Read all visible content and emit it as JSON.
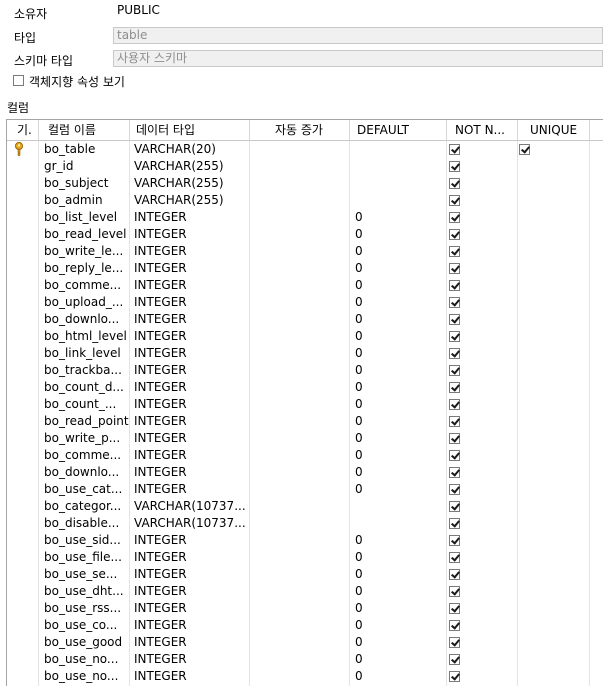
{
  "form": {
    "owner_label": "소유자",
    "owner_value": "PUBLIC",
    "type_label": "타입",
    "type_value": "table",
    "schema_type_label": "스키마 타입",
    "schema_type_value": "사용자 스키마",
    "oo_checkbox_label": "객체지향 속성 보기",
    "oo_checked": false
  },
  "section": {
    "title": "컬럼"
  },
  "grid": {
    "columns": [
      "기.",
      "컬럼 이름",
      "데이터 타입",
      "자동 증가",
      "DEFAULT",
      "NOT N...",
      "UNIQUE"
    ],
    "rows": [
      {
        "key": true,
        "name": "bo_table",
        "type": "VARCHAR(20)",
        "auto": "",
        "def": "",
        "notnull": true,
        "unique": true
      },
      {
        "key": false,
        "name": "gr_id",
        "type": "VARCHAR(255)",
        "auto": "",
        "def": "",
        "notnull": true,
        "unique": false
      },
      {
        "key": false,
        "name": "bo_subject",
        "type": "VARCHAR(255)",
        "auto": "",
        "def": "",
        "notnull": true,
        "unique": false
      },
      {
        "key": false,
        "name": "bo_admin",
        "type": "VARCHAR(255)",
        "auto": "",
        "def": "",
        "notnull": true,
        "unique": false
      },
      {
        "key": false,
        "name": "bo_list_level",
        "type": "INTEGER",
        "auto": "",
        "def": "0",
        "notnull": true,
        "unique": false
      },
      {
        "key": false,
        "name": "bo_read_level",
        "type": "INTEGER",
        "auto": "",
        "def": "0",
        "notnull": true,
        "unique": false
      },
      {
        "key": false,
        "name": "bo_write_le...",
        "type": "INTEGER",
        "auto": "",
        "def": "0",
        "notnull": true,
        "unique": false
      },
      {
        "key": false,
        "name": "bo_reply_le...",
        "type": "INTEGER",
        "auto": "",
        "def": "0",
        "notnull": true,
        "unique": false
      },
      {
        "key": false,
        "name": "bo_comme...",
        "type": "INTEGER",
        "auto": "",
        "def": "0",
        "notnull": true,
        "unique": false
      },
      {
        "key": false,
        "name": "bo_upload_...",
        "type": "INTEGER",
        "auto": "",
        "def": "0",
        "notnull": true,
        "unique": false
      },
      {
        "key": false,
        "name": "bo_downlo...",
        "type": "INTEGER",
        "auto": "",
        "def": "0",
        "notnull": true,
        "unique": false
      },
      {
        "key": false,
        "name": "bo_html_level",
        "type": "INTEGER",
        "auto": "",
        "def": "0",
        "notnull": true,
        "unique": false
      },
      {
        "key": false,
        "name": "bo_link_level",
        "type": "INTEGER",
        "auto": "",
        "def": "0",
        "notnull": true,
        "unique": false
      },
      {
        "key": false,
        "name": "bo_trackba...",
        "type": "INTEGER",
        "auto": "",
        "def": "0",
        "notnull": true,
        "unique": false
      },
      {
        "key": false,
        "name": "bo_count_d...",
        "type": "INTEGER",
        "auto": "",
        "def": "0",
        "notnull": true,
        "unique": false
      },
      {
        "key": false,
        "name": "bo_count_...",
        "type": "INTEGER",
        "auto": "",
        "def": "0",
        "notnull": true,
        "unique": false
      },
      {
        "key": false,
        "name": "bo_read_point",
        "type": "INTEGER",
        "auto": "",
        "def": "0",
        "notnull": true,
        "unique": false
      },
      {
        "key": false,
        "name": "bo_write_p...",
        "type": "INTEGER",
        "auto": "",
        "def": "0",
        "notnull": true,
        "unique": false
      },
      {
        "key": false,
        "name": "bo_comme...",
        "type": "INTEGER",
        "auto": "",
        "def": "0",
        "notnull": true,
        "unique": false
      },
      {
        "key": false,
        "name": "bo_downlo...",
        "type": "INTEGER",
        "auto": "",
        "def": "0",
        "notnull": true,
        "unique": false
      },
      {
        "key": false,
        "name": "bo_use_cat...",
        "type": "INTEGER",
        "auto": "",
        "def": "0",
        "notnull": true,
        "unique": false
      },
      {
        "key": false,
        "name": "bo_categor...",
        "type": "VARCHAR(10737...",
        "auto": "",
        "def": "",
        "notnull": true,
        "unique": false
      },
      {
        "key": false,
        "name": "bo_disable...",
        "type": "VARCHAR(10737...",
        "auto": "",
        "def": "",
        "notnull": true,
        "unique": false
      },
      {
        "key": false,
        "name": "bo_use_sid...",
        "type": "INTEGER",
        "auto": "",
        "def": "0",
        "notnull": true,
        "unique": false
      },
      {
        "key": false,
        "name": "bo_use_file...",
        "type": "INTEGER",
        "auto": "",
        "def": "0",
        "notnull": true,
        "unique": false
      },
      {
        "key": false,
        "name": "bo_use_se...",
        "type": "INTEGER",
        "auto": "",
        "def": "0",
        "notnull": true,
        "unique": false
      },
      {
        "key": false,
        "name": "bo_use_dht...",
        "type": "INTEGER",
        "auto": "",
        "def": "0",
        "notnull": true,
        "unique": false
      },
      {
        "key": false,
        "name": "bo_use_rss...",
        "type": "INTEGER",
        "auto": "",
        "def": "0",
        "notnull": true,
        "unique": false
      },
      {
        "key": false,
        "name": "bo_use_co...",
        "type": "INTEGER",
        "auto": "",
        "def": "0",
        "notnull": true,
        "unique": false
      },
      {
        "key": false,
        "name": "bo_use_good",
        "type": "INTEGER",
        "auto": "",
        "def": "0",
        "notnull": true,
        "unique": false
      },
      {
        "key": false,
        "name": "bo_use_no...",
        "type": "INTEGER",
        "auto": "",
        "def": "0",
        "notnull": true,
        "unique": false
      },
      {
        "key": false,
        "name": "bo_use_no...",
        "type": "INTEGER",
        "auto": "",
        "def": "0",
        "notnull": true,
        "unique": false
      }
    ]
  }
}
